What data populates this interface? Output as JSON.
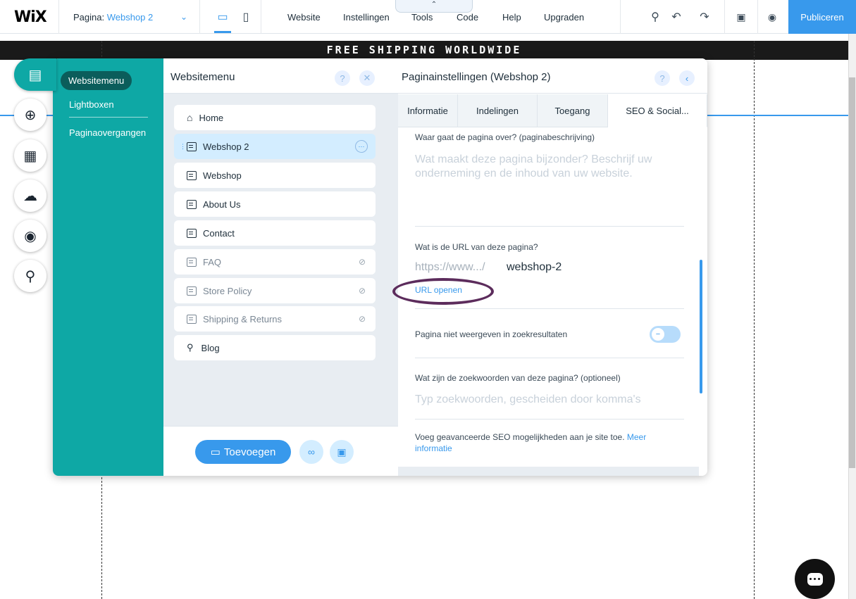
{
  "topbar": {
    "logo": "WiX",
    "page_label": "Pagina:",
    "page_name": "Webshop 2",
    "menu": [
      "Website",
      "Instellingen",
      "Tools",
      "Code",
      "Help",
      "Upgraden"
    ],
    "publish": "Publiceren"
  },
  "canvas": {
    "banner": "FREE SHIPPING WORLDWIDE"
  },
  "left_menu": {
    "items": [
      "Websitemenu",
      "Lightboxen",
      "Paginaovergangen"
    ]
  },
  "pages_panel": {
    "title": "Websitemenu",
    "pages": [
      {
        "name": "Home",
        "hidden": false
      },
      {
        "name": "Webshop 2",
        "hidden": false
      },
      {
        "name": "Webshop",
        "hidden": false
      },
      {
        "name": "About Us",
        "hidden": false
      },
      {
        "name": "Contact",
        "hidden": false
      },
      {
        "name": "FAQ",
        "hidden": true
      },
      {
        "name": "Store Policy",
        "hidden": true
      },
      {
        "name": "Shipping & Returns",
        "hidden": true
      },
      {
        "name": "Blog",
        "hidden": false
      }
    ],
    "add_button": "Toevoegen"
  },
  "settings_panel": {
    "title": "Paginainstellingen (Webshop 2)",
    "tabs": [
      "Informatie",
      "Indelingen",
      "Toegang",
      "SEO & Social..."
    ],
    "active_tab": "SEO & Social...",
    "description_label": "Waar gaat de pagina over? (paginabeschrijving)",
    "description_placeholder": "Wat maakt deze pagina bijzonder? Beschrijf uw onderneming en de inhoud van uw website.",
    "url_label": "Wat is de URL van deze pagina?",
    "url_prefix": "https://www.../",
    "url_slug": "webshop-2",
    "url_open": "URL openen",
    "hide_label": "Pagina niet weergeven in zoekresultaten",
    "keywords_label": "Wat zijn de zoekwoorden van deze pagina? (optioneel)",
    "keywords_placeholder": "Typ zoekwoorden, gescheiden door komma's",
    "advanced_text": "Voeg geavanceerde SEO mogelijkheden aan je site toe.",
    "advanced_link": "Meer informatie"
  },
  "colors": {
    "accent": "#3899ec",
    "teal": "#0ea8a5",
    "annotation": "#5c2c5c"
  }
}
